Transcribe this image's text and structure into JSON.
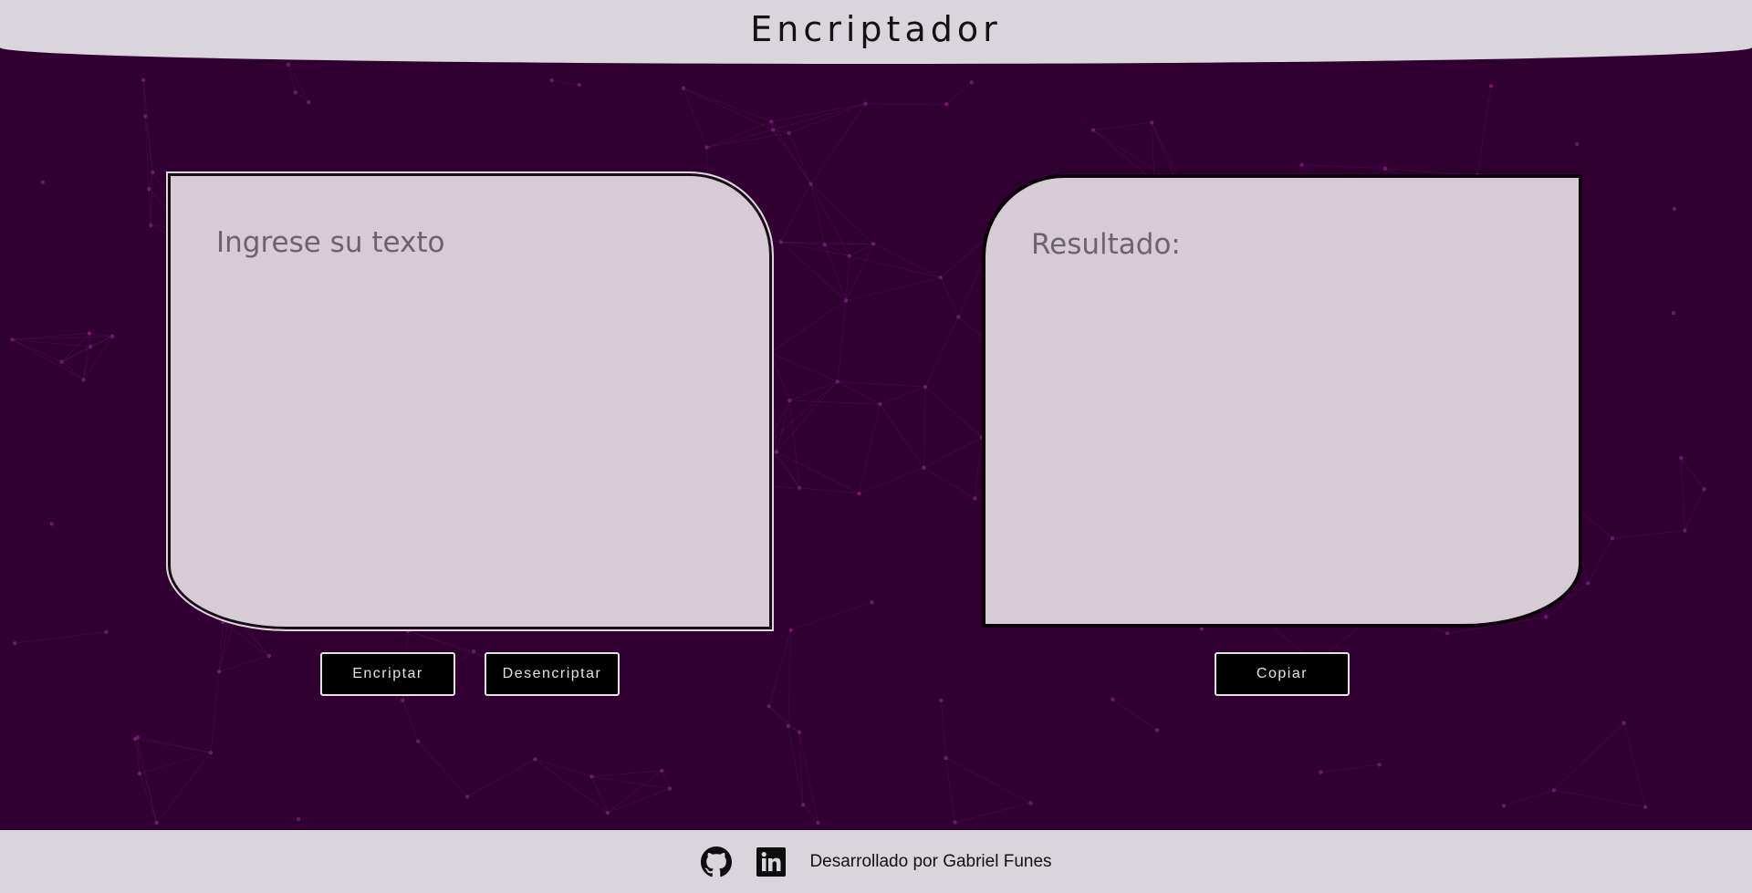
{
  "header": {
    "title": "Encriptador"
  },
  "input_panel": {
    "placeholder": "Ingrese su texto",
    "value": ""
  },
  "output_panel": {
    "label": "Resultado:"
  },
  "buttons": {
    "encrypt_label": "Encriptar",
    "decrypt_label": "Desencriptar",
    "copy_label": "Copiar"
  },
  "footer": {
    "credit": "Desarrollado por Gabriel Funes",
    "icons": [
      "github-icon",
      "linkedin-icon"
    ]
  },
  "colors": {
    "background": "#2f0030",
    "header_footer": "#dad5dc",
    "panel": "#d7cbd5",
    "button": "#000000",
    "button_text": "#e6e0e6"
  }
}
